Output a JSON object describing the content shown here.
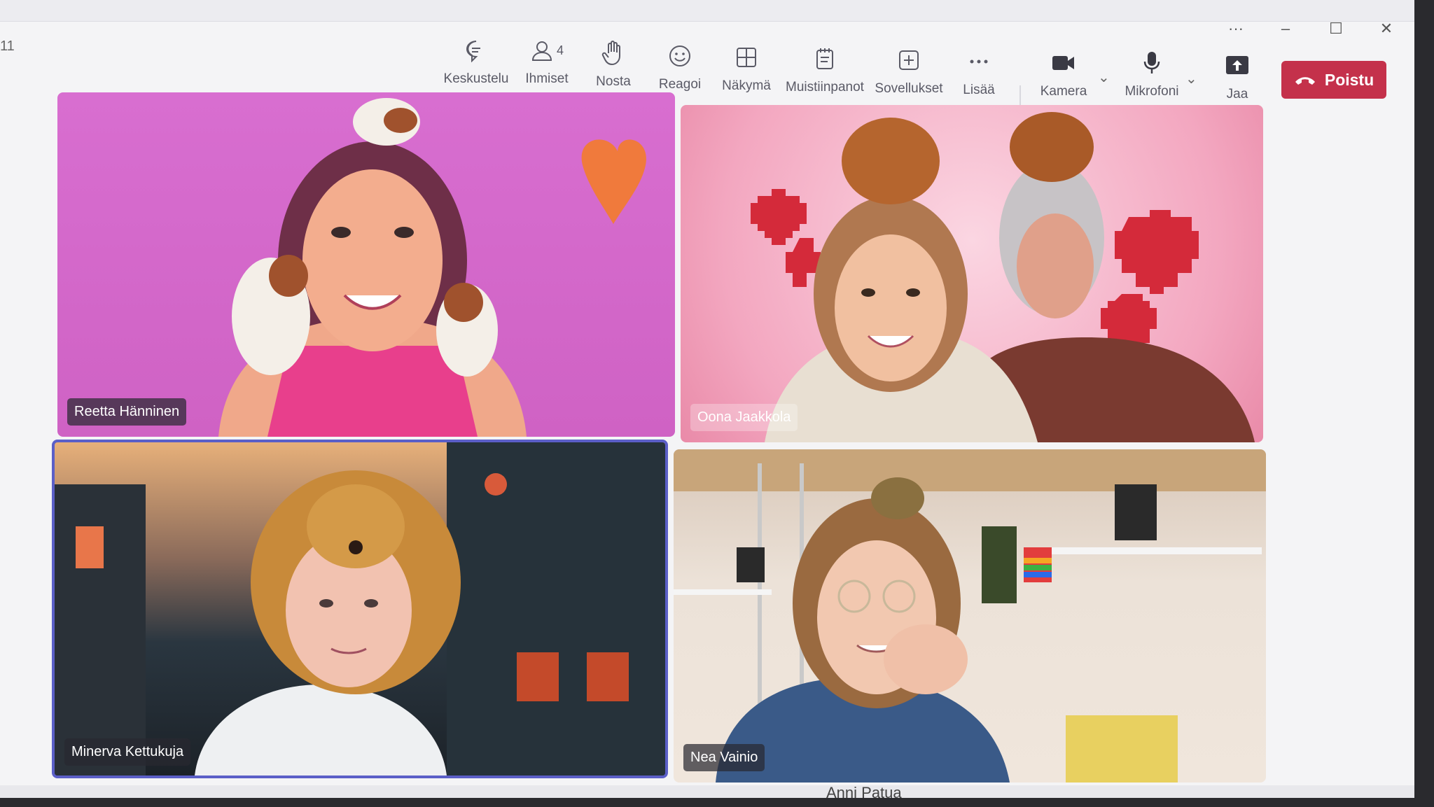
{
  "window": {
    "time": "11",
    "more": "···",
    "minimize": "–",
    "maximize": "☐",
    "close": "✕"
  },
  "toolbar": {
    "items": [
      {
        "label": "Keskustelu",
        "icon": "chat-icon"
      },
      {
        "label": "Ihmiset",
        "icon": "people-icon",
        "count": "4"
      },
      {
        "label": "Nosta",
        "icon": "raise-hand-icon"
      },
      {
        "label": "Reagoi",
        "icon": "smiley-icon"
      },
      {
        "label": "Näkymä",
        "icon": "grid-view-icon"
      },
      {
        "label": "Muistiinpanot",
        "icon": "notes-icon"
      },
      {
        "label": "Sovellukset",
        "icon": "plus-square-icon"
      },
      {
        "label": "Lisää",
        "icon": "more-dots-icon"
      },
      {
        "label": "Kamera",
        "icon": "camera-icon"
      },
      {
        "label": "Mikrofoni",
        "icon": "microphone-icon"
      },
      {
        "label": "Jaa",
        "icon": "share-icon"
      }
    ],
    "leave_label": "Poistu"
  },
  "participants": [
    {
      "name": "Reetta Hänninen"
    },
    {
      "name": "Oona Jaakkola"
    },
    {
      "name": "Minerva Kettukuja",
      "active": true
    },
    {
      "name": "Nea Vainio"
    }
  ],
  "bottom": {
    "name": "Anni Patua"
  },
  "colors": {
    "leave": "#c4314b",
    "active_border": "#5b5fc7"
  }
}
